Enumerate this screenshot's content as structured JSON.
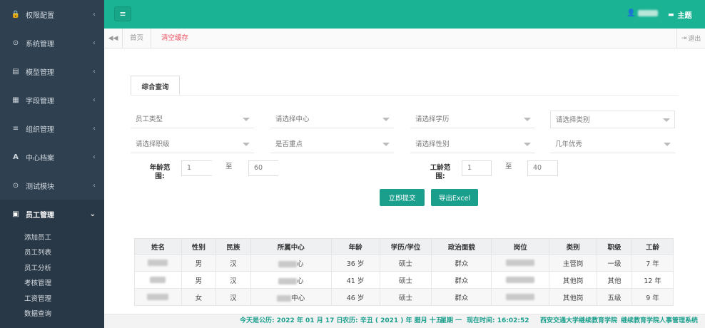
{
  "sidebar": {
    "items": [
      {
        "label": "权限配置",
        "icon": "lock-icon",
        "glyph": "🔒"
      },
      {
        "label": "系统管理",
        "icon": "settings-circle-icon",
        "glyph": "⊙"
      },
      {
        "label": "模型管理",
        "icon": "model-icon",
        "glyph": "▤"
      },
      {
        "label": "字段管理",
        "icon": "grid-icon",
        "glyph": "▦"
      },
      {
        "label": "组织管理",
        "icon": "list-icon",
        "glyph": "≡"
      },
      {
        "label": "中心档案",
        "icon": "font-icon",
        "glyph": "A"
      },
      {
        "label": "测试模块",
        "icon": "target-icon",
        "glyph": "⊙"
      },
      {
        "label": "员工管理",
        "icon": "form-icon",
        "glyph": "▣"
      }
    ],
    "sub_items": [
      "添加员工",
      "员工列表",
      "员工分析",
      "考核管理",
      "工资管理",
      "数据查询"
    ]
  },
  "topbar": {
    "theme_label": "主题"
  },
  "tabs": {
    "home": "首页",
    "clear": "清空缓存",
    "logout": "退出"
  },
  "search": {
    "tab_label": "综合查询",
    "selects_row1": [
      "员工类型",
      "请选择中心",
      "请选择学历",
      "请选择类别"
    ],
    "selects_row2": [
      "请选择职级",
      "是否重点",
      "请选择性别",
      "几年优秀"
    ],
    "age_label_1": "年龄范",
    "age_label_2": "围:",
    "age_from": "1",
    "age_to": "60",
    "work_label_1": "工龄范",
    "work_label_2": "围:",
    "work_from": "1",
    "work_to": "40",
    "to_text": "至",
    "submit_label": "立即提交",
    "export_label": "导出Excel"
  },
  "table": {
    "headers": [
      "姓名",
      "性别",
      "民族",
      "所属中心",
      "年龄",
      "学历/学位",
      "政治面貌",
      "岗位",
      "类别",
      "职级",
      "工龄"
    ],
    "rows": [
      {
        "gender": "男",
        "ethnic": "汉",
        "center_suffix": "心",
        "age": "36 岁",
        "degree": "硕士",
        "political": "群众",
        "category": "主营岗",
        "rank": "一级",
        "work_years": "7 年"
      },
      {
        "gender": "男",
        "ethnic": "汉",
        "center_suffix": "心",
        "age": "41 岁",
        "degree": "硕士",
        "political": "群众",
        "category": "其他岗",
        "rank": "其他",
        "work_years": "12 年"
      },
      {
        "gender": "女",
        "ethnic": "汉",
        "center_suffix": "中心",
        "age": "46 岁",
        "degree": "硕士",
        "political": "群众",
        "category": "其他岗",
        "rank": "五级",
        "work_years": "9 年"
      }
    ]
  },
  "footer": {
    "date_text": "今天是公历: 2022 年 01 月 17 日",
    "lunar_text": "农历: 辛丑 ( 2021 ) 年 腊月 十五",
    "weekday_text": "星期 一",
    "time_text": "现在时间: 16:02:52",
    "org1": "西安交通大学继续教育学院",
    "org2": "继续教育学院人事管理系统"
  },
  "colors": {
    "sidebar_bg": "#2f4050",
    "accent": "#1ab394",
    "button": "#1a9f8c",
    "danger": "#ed5565"
  }
}
